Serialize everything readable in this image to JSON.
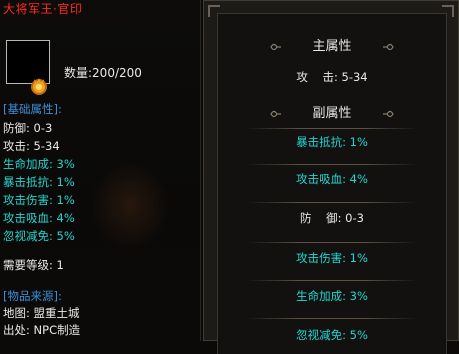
{
  "tooltip": {
    "title": "大将军王·官印",
    "quantity": "数量:200/200",
    "base_header": "[基础属性]:",
    "base_stats": [
      {
        "text": "防御: 0-3",
        "color": "white"
      },
      {
        "text": "攻击: 5-34",
        "color": "white"
      },
      {
        "text": "生命加成: 3%",
        "color": "cyan"
      },
      {
        "text": "暴击抵抗: 1%",
        "color": "cyan"
      },
      {
        "text": "攻击伤害: 1%",
        "color": "cyan"
      },
      {
        "text": "攻击吸血: 4%",
        "color": "cyan"
      },
      {
        "text": "忽视减免: 5%",
        "color": "cyan"
      }
    ],
    "level_req": "需要等级: 1",
    "source_header": "[物品来源]:",
    "source_lines": [
      "地图: 盟重土城",
      "出处: NPC制造"
    ],
    "colors": {
      "title": "#ff2a1a",
      "white": "#e8e8e8",
      "cyan": "#23d6d2",
      "blue": "#3a8fd9"
    }
  },
  "attributes": {
    "main_header": "主属性",
    "main_rows": [
      "攻    击: 5-34"
    ],
    "sub_header": "副属性",
    "sub_rows": [
      {
        "text": "暴击抵抗: 1%",
        "color": "cyan"
      },
      {
        "text": "攻击吸血: 4%",
        "color": "cyan"
      },
      {
        "text": "防    御: 0-3",
        "color": "white"
      },
      {
        "text": "攻击伤害: 1%",
        "color": "cyan"
      },
      {
        "text": "生命加成: 3%",
        "color": "cyan"
      },
      {
        "text": "忽视减免: 5%",
        "color": "cyan"
      }
    ]
  }
}
